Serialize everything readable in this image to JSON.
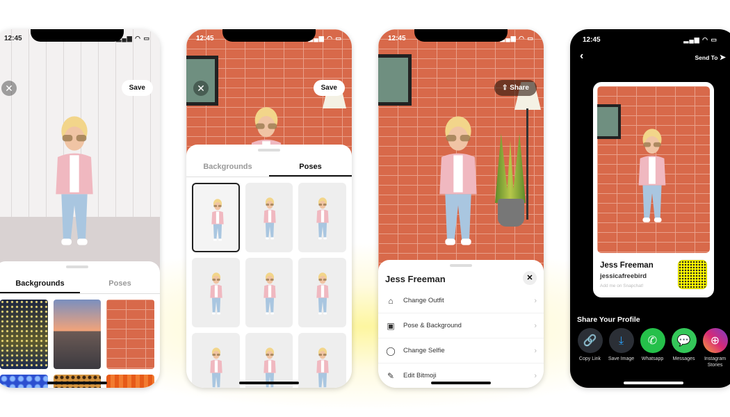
{
  "time": "12:45",
  "status_icons": "▂▄▆ ◠ ▭",
  "phone1": {
    "close_icon": "close-icon",
    "save_label": "Save",
    "tabs": [
      {
        "label": "Backgrounds",
        "active": true
      },
      {
        "label": "Poses",
        "active": false
      }
    ],
    "backgrounds": [
      "lights",
      "pier-sunset",
      "brick-wall",
      "blue-bokeh",
      "leopard",
      "orange-curtain"
    ]
  },
  "phone2": {
    "save_label": "Save",
    "tabs": [
      {
        "label": "Backgrounds",
        "active": false
      },
      {
        "label": "Poses",
        "active": true
      }
    ],
    "poses_count_visible": 9,
    "selected_pose": 1
  },
  "phone3": {
    "share_label": "Share",
    "sheet_title": "Jess Freeman",
    "menu": [
      {
        "label": "Change Outfit",
        "icon": "hanger-icon"
      },
      {
        "label": "Pose & Background",
        "icon": "image-icon"
      },
      {
        "label": "Change Selfie",
        "icon": "face-icon"
      },
      {
        "label": "Edit Bitmoji",
        "icon": "pencil-icon"
      }
    ]
  },
  "phone4": {
    "send_to_label": "Send To",
    "card": {
      "name": "Jess Freeman",
      "username": "jessicafreebird",
      "subtitle": "Add me on Snapchat!"
    },
    "share_title": "Share Your Profile",
    "share": [
      {
        "label": "Copy Link",
        "color": "#2b2f36",
        "icon": "link-icon"
      },
      {
        "label": "Save Image",
        "color": "#2b2f36",
        "icon": "download-icon"
      },
      {
        "label": "Whatsapp",
        "color": "#25c04a",
        "icon": "whatsapp-icon"
      },
      {
        "label": "Messages",
        "color": "#34c759",
        "icon": "message-icon"
      },
      {
        "label": "Instagram Stories",
        "color": "#c13584",
        "icon": "instagram-icon"
      }
    ]
  },
  "colors": {
    "snap_yellow": "#fffc00",
    "brick": "#d8694a"
  }
}
